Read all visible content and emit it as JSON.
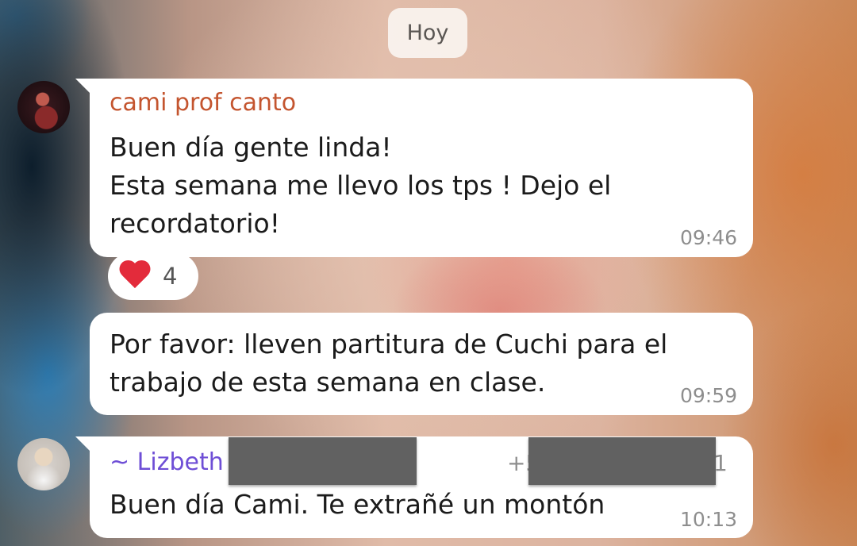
{
  "date_chip": "Hoy",
  "messages": [
    {
      "sender": "cami prof canto",
      "sender_color": "#c4552f",
      "lines": [
        "Buen día gente linda!",
        "Esta semana me llevo los tps ! Dejo el",
        "recordatorio!"
      ],
      "time": "09:46",
      "reaction": {
        "emoji": "heart-icon",
        "count": "4"
      }
    },
    {
      "lines": [
        "Por favor: lleven partitura de Cuchi para el",
        "trabajo de esta semana en clase."
      ],
      "time": "09:59"
    },
    {
      "sender": "~ Lizbeth",
      "sender_color": "#6e4ed6",
      "phone_prefix": "+5",
      "phone_suffix": "1",
      "lines": [
        "Buen día Cami. Te extrañé un montón"
      ],
      "time": "10:13"
    }
  ]
}
